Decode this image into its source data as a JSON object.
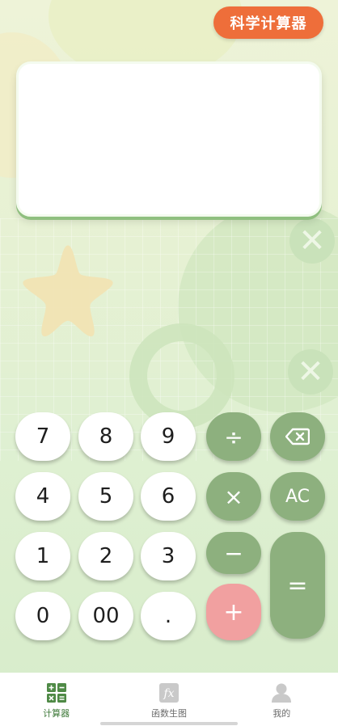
{
  "header": {
    "science_button_label": "科学计算器"
  },
  "display": {
    "expression": "",
    "result": ""
  },
  "keypad": {
    "digits": {
      "seven": "7",
      "eight": "8",
      "nine": "9",
      "four": "4",
      "five": "5",
      "six": "6",
      "one": "1",
      "two": "2",
      "three": "3",
      "zero": "0",
      "double_zero": "00",
      "dot": "."
    },
    "ops": {
      "divide": "÷",
      "backspace_icon": "backspace-icon",
      "multiply": "×",
      "clear": "AC",
      "minus": "−",
      "plus": "+",
      "equals": "="
    }
  },
  "tabs": [
    {
      "label": "计算器",
      "icon": "calculator-icon",
      "active": true
    },
    {
      "label": "函数生图",
      "icon": "function-graph-icon",
      "active": false
    },
    {
      "label": "我的",
      "icon": "profile-icon",
      "active": false
    }
  ],
  "colors": {
    "accent_orange": "#ee6e3a",
    "op_green": "#8db07e",
    "plus_pink": "#f1a0a0",
    "active_tab": "#3f7a3a"
  }
}
